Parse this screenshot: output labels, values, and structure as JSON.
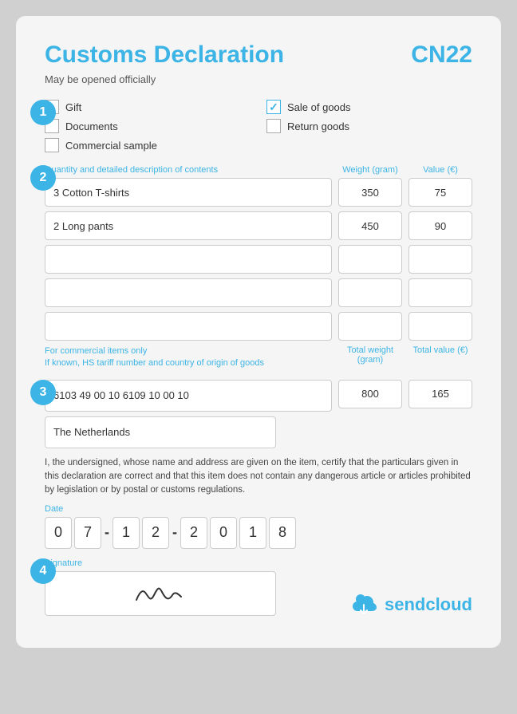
{
  "header": {
    "title": "Customs Declaration",
    "cn22": "CN22",
    "subtitle": "May be opened officially"
  },
  "section1": {
    "marker": "1",
    "checkboxes": [
      {
        "label": "Gift",
        "checked": false
      },
      {
        "label": "Sale of goods",
        "checked": true
      },
      {
        "label": "Documents",
        "checked": false
      },
      {
        "label": "Return goods",
        "checked": false
      },
      {
        "label": "Commercial sample",
        "checked": false
      }
    ]
  },
  "section2": {
    "marker": "2",
    "col_desc": "Quantity and detailed description of contents",
    "col_weight": "Weight (gram)",
    "col_value": "Value (€)",
    "items": [
      {
        "desc": "3 Cotton T-shirts",
        "weight": "350",
        "value": "75"
      },
      {
        "desc": "2 Long pants",
        "weight": "450",
        "value": "90"
      },
      {
        "desc": "",
        "weight": "",
        "value": ""
      },
      {
        "desc": "",
        "weight": "",
        "value": ""
      },
      {
        "desc": "",
        "weight": "",
        "value": ""
      }
    ],
    "footer_commercial": "For commercial items only",
    "footer_hs": "If known, HS tariff number and country of origin of goods",
    "footer_total_weight": "Total weight (gram)",
    "footer_total_value": "Total value (€)"
  },
  "section3": {
    "marker": "3",
    "hs_numbers": "6103 49 00 10      6109 10 00 10",
    "total_weight": "800",
    "total_value": "165",
    "country": "The Netherlands",
    "cert_text": "I, the undersigned, whose name and address are given on the item, certify that the particulars given in this declaration are correct and that this item does not contain any dangerous article or articles prohibited by legislation or by postal or customs regulations."
  },
  "date": {
    "label": "Date",
    "digits": [
      "0",
      "7",
      "-",
      "1",
      "2",
      "-",
      "2",
      "0",
      "1",
      "8"
    ]
  },
  "section4": {
    "marker": "4",
    "sig_label": "Signature",
    "sendcloud_label": "sendcloud"
  }
}
